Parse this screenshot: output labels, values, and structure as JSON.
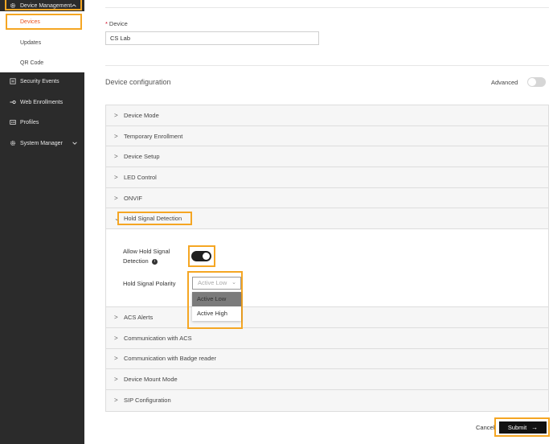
{
  "sidebar": {
    "section": "Device Management",
    "sub_items": [
      "Devices",
      "Updates",
      "QR Code"
    ],
    "items": [
      {
        "label": "Security Events",
        "icon": "list-icon"
      },
      {
        "label": "Web Enrollments",
        "icon": "key-icon"
      },
      {
        "label": "Profiles",
        "icon": "id-card-icon"
      },
      {
        "label": "System Manager",
        "icon": "gear-icon"
      }
    ]
  },
  "device": {
    "label": "Device",
    "required_mark": "*",
    "value": "CS Lab"
  },
  "config": {
    "title": "Device configuration",
    "advanced_label": "Advanced",
    "sections_before": [
      "Device Mode",
      "Temporary Enrollment",
      "Device Setup",
      "LED Control",
      "ONVIF"
    ],
    "open_section": "Hold Signal Detection",
    "sections_after": [
      "ACS Alerts",
      "Communication with ACS",
      "Communication with Badge reader",
      "Device Mount Mode",
      "SIP Configuration"
    ]
  },
  "hold_signal": {
    "allow_label": "Allow Hold Signal Detection",
    "allow_enabled": true,
    "polarity_label": "Hold Signal Polarity",
    "polarity_value": "Active Low",
    "polarity_options": [
      "Active Low",
      "Active High"
    ]
  },
  "footer": {
    "cancel_label": "Cancel",
    "submit_label": "Submit"
  },
  "colors": {
    "highlight": "#f5a623",
    "active_nav": "#e8531f",
    "sidebar_bg": "#2b2b2b"
  }
}
